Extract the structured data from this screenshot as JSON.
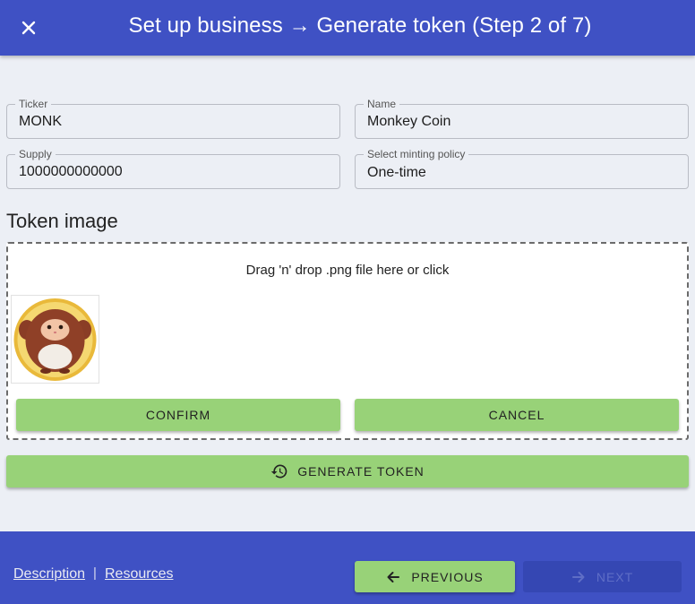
{
  "header": {
    "title": "Set up business → Generate token (Step 2 of 7)"
  },
  "form": {
    "ticker": {
      "label": "Ticker",
      "value": "MONK"
    },
    "name": {
      "label": "Name",
      "value": "Monkey Coin"
    },
    "supply": {
      "label": "Supply",
      "value": "1000000000000"
    },
    "minting_policy": {
      "label": "Select minting policy",
      "value": "One-time"
    }
  },
  "token_image": {
    "title": "Token image",
    "drop_text": "Drag 'n' drop .png file here or click",
    "confirm_label": "CONFIRM",
    "cancel_label": "CANCEL"
  },
  "generate_label": "GENERATE TOKEN",
  "footer": {
    "description_link": "Description",
    "separator": "|",
    "resources_link": "Resources",
    "previous_label": "PREVIOUS",
    "next_label": "NEXT"
  },
  "colors": {
    "primary": "#3f51c4",
    "accent_button": "#98d278",
    "background": "#eceff5"
  }
}
